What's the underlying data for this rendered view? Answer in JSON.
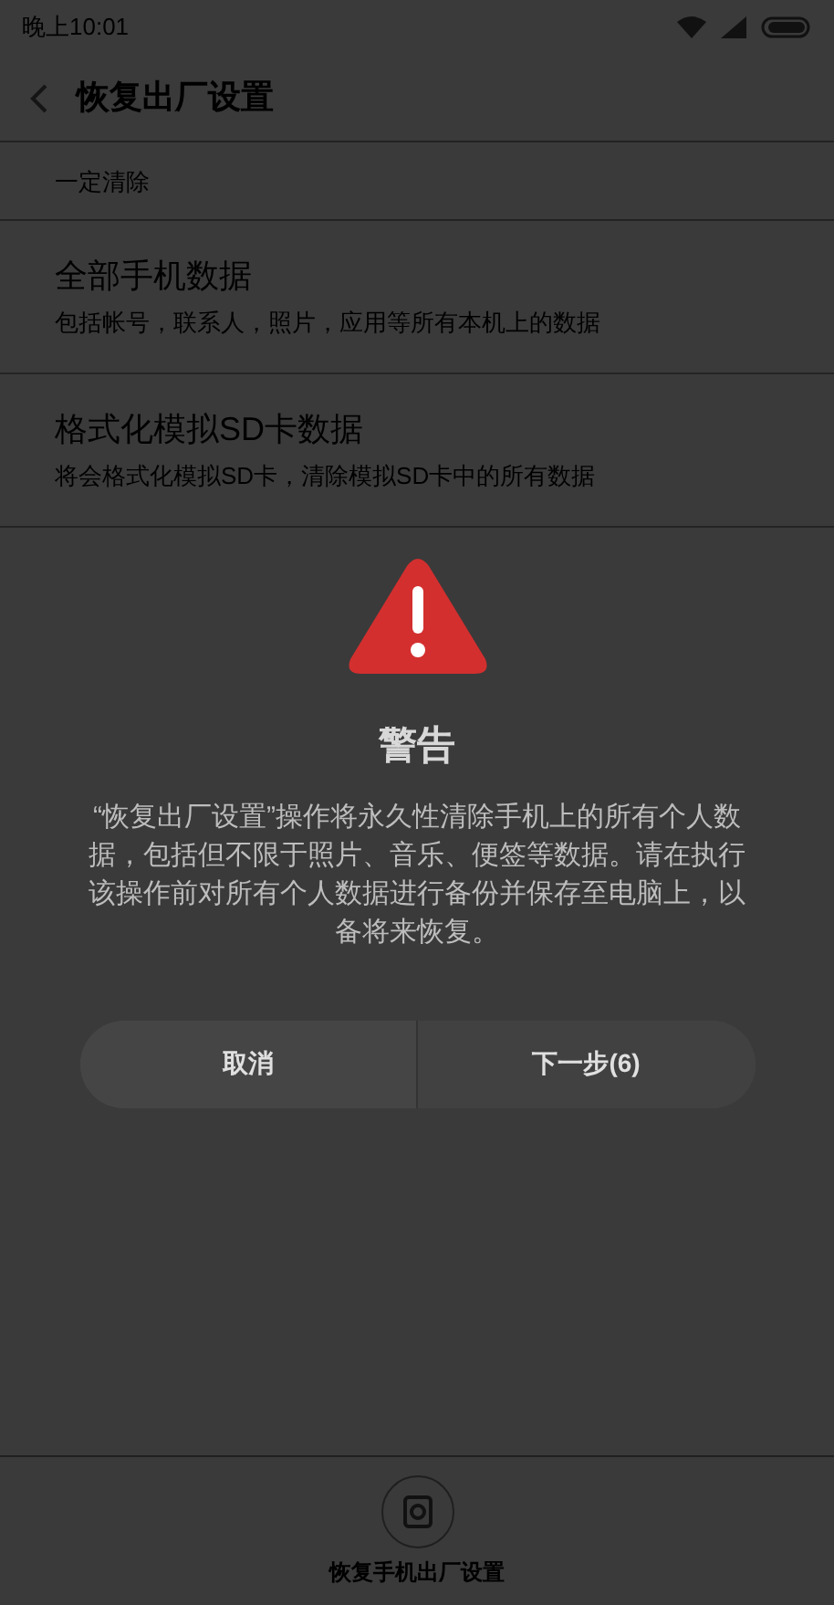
{
  "status_bar": {
    "time": "晚上10:01"
  },
  "header": {
    "title": "恢复出厂设置"
  },
  "section": {
    "label": "一定清除"
  },
  "items": [
    {
      "title": "全部手机数据",
      "subtitle": "包括帐号，联系人，照片，应用等所有本机上的数据"
    },
    {
      "title": "格式化模拟SD卡数据",
      "subtitle": "将会格式化模拟SD卡，清除模拟SD卡中的所有数据"
    }
  ],
  "dialog": {
    "title": "警告",
    "message": "“恢复出厂设置”操作将永久性清除手机上的所有个人数据，包括但不限于照片、音乐、便签等数据。请在执行该操作前对所有个人数据进行备份并保存至电脑上，以备将来恢复。",
    "buttons": [
      "取消",
      "下一步(6)"
    ]
  },
  "bottom_action": {
    "label": "恢复手机出厂设置"
  }
}
